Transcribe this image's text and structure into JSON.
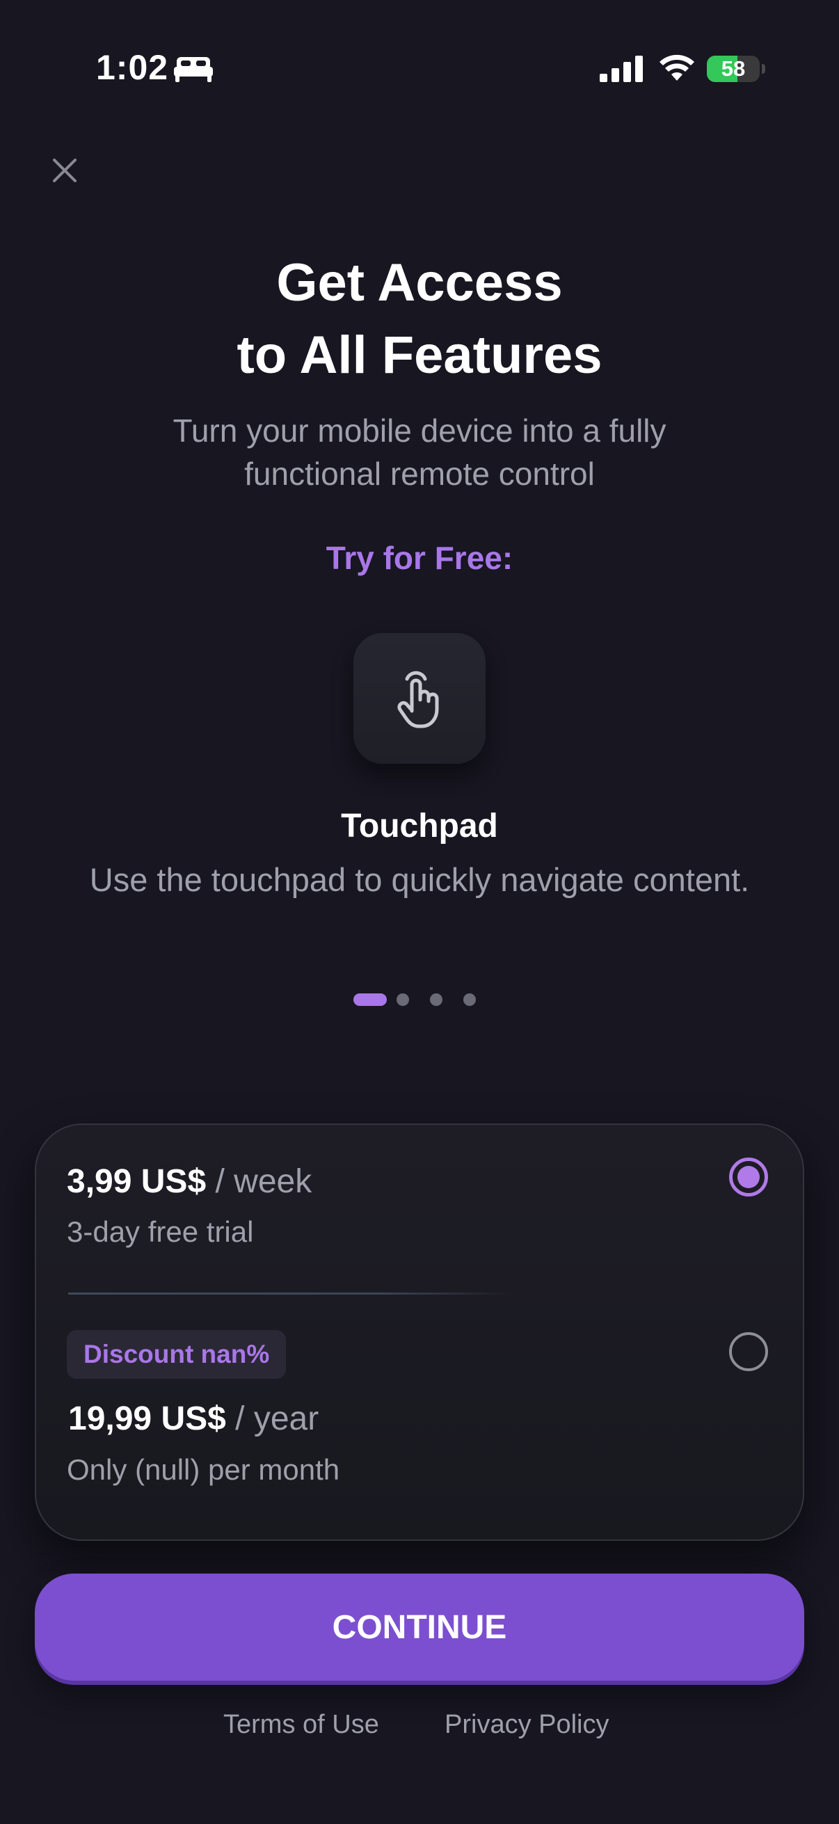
{
  "status_bar": {
    "time": "1:02",
    "battery_percent": "58",
    "battery_level": 0.58,
    "icons": [
      "bed-icon",
      "cellular-signal-icon",
      "wifi-icon",
      "battery-charging-icon"
    ]
  },
  "header": {
    "close_icon": "close-icon",
    "title_line1": "Get Access",
    "title_line2": "to All Features",
    "subtitle": "Turn your mobile device into a fully functional remote control"
  },
  "trial": {
    "label": "Try for Free:",
    "feature": {
      "icon": "touch-hand-icon",
      "title": "Touchpad",
      "description": "Use the touchpad to quickly navigate content."
    },
    "pager": {
      "count": 4,
      "active_index": 0
    }
  },
  "plans": [
    {
      "price": "3,99 US$",
      "period": "/ week",
      "subtitle": "3-day free trial",
      "selected": true
    },
    {
      "badge": "Discount nan%",
      "price": "19,99 US$",
      "period": "/ year",
      "subtitle": "Only (null) per month",
      "selected": false
    }
  ],
  "cta": {
    "label": "CONTINUE"
  },
  "footer": {
    "terms": "Terms of Use",
    "privacy": "Privacy Policy"
  },
  "colors": {
    "background": "#171621",
    "accent": "#a977e8",
    "button": "#7c4fd0",
    "muted_text": "#9fa0ab",
    "battery_green": "#34c759"
  }
}
